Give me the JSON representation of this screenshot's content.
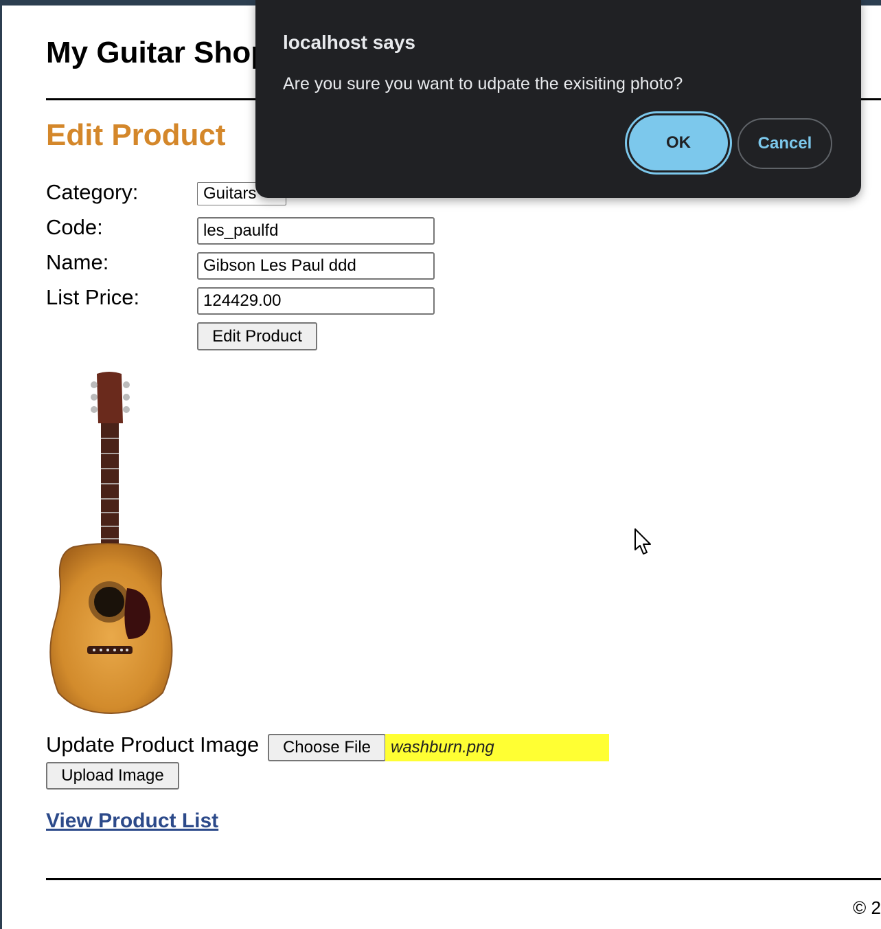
{
  "site": {
    "title": "My Guitar Shop"
  },
  "page": {
    "heading": "Edit Product"
  },
  "form": {
    "category_label": "Category:",
    "category_value": "Guitars",
    "code_label": "Code:",
    "code_value": "les_paulfd",
    "name_label": "Name:",
    "name_value": "Gibson Les Paul ddd",
    "price_label": "List Price:",
    "price_value": "124429.00",
    "submit_label": "Edit Product"
  },
  "image_section": {
    "image_alt": "acoustic guitar product photo",
    "update_label": "Update Product Image",
    "choose_file_label": "Choose File",
    "chosen_file": "washburn.png",
    "upload_label": "Upload Image"
  },
  "links": {
    "view_list": "View Product List"
  },
  "footer": {
    "copyright": "© 2"
  },
  "dialog": {
    "title": "localhost says",
    "message": "Are you sure you want to udpate the exisiting photo?",
    "ok_label": "OK",
    "cancel_label": "Cancel"
  },
  "colors": {
    "heading": "#d4872a",
    "dialog_bg": "#202124",
    "ok_button": "#7cc8ec",
    "file_highlight": "#ffff33",
    "link": "#2c4a8a"
  }
}
